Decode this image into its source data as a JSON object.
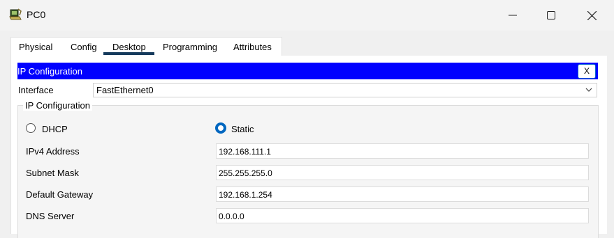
{
  "window": {
    "title": "PC0",
    "icon": "pc-icon"
  },
  "tabs": [
    {
      "label": "Physical"
    },
    {
      "label": "Config"
    },
    {
      "label": "Desktop",
      "active": true
    },
    {
      "label": "Programming"
    },
    {
      "label": "Attributes"
    }
  ],
  "ip_config": {
    "header_title": "IP Configuration",
    "close_label": "X",
    "interface_label": "Interface",
    "interface_value": "FastEthernet0",
    "group_title": "IP Configuration",
    "dhcp_label": "DHCP",
    "static_label": "Static",
    "mode": "Static",
    "fields": {
      "ipv4_label": "IPv4 Address",
      "ipv4_value": "192.168.111.1",
      "subnet_label": "Subnet Mask",
      "subnet_value": "255.255.255.0",
      "gateway_label": "Default Gateway",
      "gateway_value": "192.168.1.254",
      "dns_label": "DNS Server",
      "dns_value": "0.0.0.0"
    }
  },
  "colors": {
    "header_blue": "#0000ff",
    "tab_underline": "#153a5c",
    "radio_selected": "#0067c0"
  }
}
